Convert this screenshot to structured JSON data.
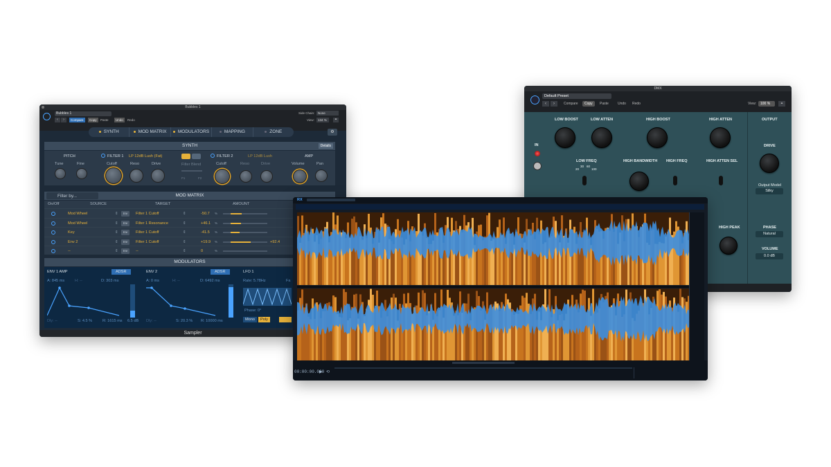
{
  "sampler": {
    "window_title": "Bubbles 1",
    "preset_name": "Bubbles 1",
    "side_chain_label": "Side Chain:",
    "side_chain_value": "None",
    "view_label": "View:",
    "view_value": "134 %",
    "buttons": {
      "compare": "Compare",
      "copy": "Copy",
      "paste": "Paste",
      "undo": "Undo",
      "redo": "Redo"
    },
    "tabs": [
      "SYNTH",
      "MOD MATRIX",
      "MODULATORS",
      "MAPPING",
      "ZONE"
    ],
    "synth": {
      "title": "SYNTH",
      "details": "Details",
      "pitch": {
        "title": "PITCH",
        "tune": "Tune",
        "fine": "Fine"
      },
      "filter1": {
        "title": "FILTER 1",
        "type": "LP 12dB Lush (Fat)",
        "cutoff": "Cutoff",
        "reso": "Reso",
        "drive": "Drive"
      },
      "filter_blend": {
        "label": "Filter Blend",
        "left": "F1",
        "right": "F2"
      },
      "filter2": {
        "title": "FILTER 2",
        "type": "LP 12dB Lush",
        "cutoff": "Cutoff",
        "reso": "Reso",
        "drive": "Drive"
      },
      "amp": {
        "title": "AMP",
        "volume": "Volume",
        "pan": "Pan"
      }
    },
    "mod_matrix": {
      "title": "MOD MATRIX",
      "filter_placeholder": "Filter by...",
      "columns": [
        "On/Off",
        "SOURCE",
        "TARGET",
        "AMOUNT"
      ],
      "inv": "Inv",
      "rows": [
        {
          "source": "Mod Wheel",
          "target": "Filter 1 Cutoff",
          "amount": "-50.7",
          "unit": "%",
          "amount2": "",
          "fill": 0.25
        },
        {
          "source": "Mod Wheel",
          "target": "Filter 1 Resonance",
          "amount": "+46.1",
          "unit": "%",
          "amount2": "",
          "fill": 0.23
        },
        {
          "source": "Key",
          "target": "Filter 1 Cutoff",
          "amount": "-41.5",
          "unit": "%",
          "amount2": "",
          "fill": 0.2
        },
        {
          "source": "Env 2",
          "target": "Filter 1 Cutoff",
          "amount": "+19.9",
          "unit": "%",
          "amount2": "+92.4",
          "fill": 0.46
        },
        {
          "source": "--",
          "target": "--",
          "amount": "0",
          "unit": "%",
          "amount2": "",
          "fill": 0
        }
      ]
    },
    "modulators": {
      "title": "MODULATORS",
      "env1": {
        "title": "ENV 1 AMP",
        "mode": "ADSR",
        "attack": "A: 845 ms",
        "hold": "H: --",
        "decay": "D: 303 ms",
        "delay": "Dly: --",
        "sustain": "S: 4.5 %",
        "release": "R: 1615 ms",
        "amount": "6.5 dB"
      },
      "env2": {
        "title": "ENV 2",
        "mode": "ADSR",
        "attack": "A: 0 ms",
        "hold": "H: --",
        "decay": "D: 6492 ms",
        "delay": "Dly: --",
        "sustain": "S: 20.3 %",
        "release": "R: 10000 ms"
      },
      "lfo1": {
        "title": "LFO 1",
        "rate": "Rate: 5.78Hz",
        "fade": "Fa",
        "phase": "Phase: 0°",
        "mono": "Mono",
        "poly": "Poly"
      }
    },
    "footer": "Sampler"
  },
  "dmx": {
    "window_title": "DMX",
    "preset": "Default Preset",
    "buttons": {
      "compare": "Compare",
      "copy": "Copy",
      "paste": "Paste",
      "undo": "Undo",
      "redo": "Redo"
    },
    "view_label": "View:",
    "view_value": "100 %",
    "in_label": "IN",
    "knobs": {
      "low_boost": "LOW BOOST",
      "low_atten": "LOW ATTEN",
      "high_boost": "HIGH BOOST",
      "high_atten": "HIGH ATTEN",
      "low_freq": "LOW FREQ",
      "high_bandwidth": "HIGH BANDWIDTH",
      "high_freq": "HIGH FREQ",
      "high_atten_sel": "HIGH ATTEN SEL",
      "high_peak": "HIGH PEAK"
    },
    "low_freq_ticks": [
      "20",
      "30",
      "60",
      "100"
    ],
    "output": {
      "title": "OUTPUT",
      "drive": "DRIVE",
      "output_model_label": "Output Model",
      "output_model": "Silky",
      "phase_label": "PHASE",
      "phase": "Natural",
      "volume_label": "VOLUME",
      "volume": "0.0 dB"
    }
  },
  "rx": {
    "app_logo": "RX",
    "timecode": "00:00:00.000"
  }
}
